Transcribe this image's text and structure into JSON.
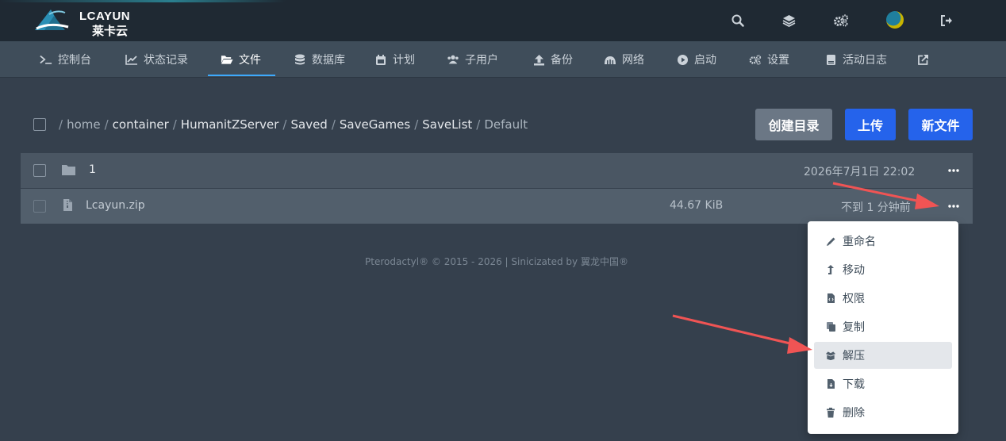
{
  "brand": {
    "name": "LCAYUN",
    "sub": "莱卡云"
  },
  "topbar": {
    "icons": [
      "search-icon",
      "layers-icon",
      "cogs-icon",
      "avatar",
      "sign-out-icon"
    ]
  },
  "nav": [
    {
      "label": "控制台",
      "icon": "terminal-icon"
    },
    {
      "label": "状态记录",
      "icon": "chart-line-icon"
    },
    {
      "label": "文件",
      "icon": "folder-open-icon",
      "active": true
    },
    {
      "label": "数据库",
      "icon": "database-icon"
    },
    {
      "label": "计划",
      "icon": "calendar-icon"
    },
    {
      "label": "子用户",
      "icon": "users-icon"
    },
    {
      "label": "备份",
      "icon": "upload-icon"
    },
    {
      "label": "网络",
      "icon": "network-icon"
    },
    {
      "label": "启动",
      "icon": "play-icon"
    },
    {
      "label": "设置",
      "icon": "cogs-icon"
    },
    {
      "label": "活动日志",
      "icon": "clipboard-icon"
    },
    {
      "label": "",
      "icon": "external-link-icon"
    }
  ],
  "breadcrumb": {
    "root": "/",
    "parts": [
      "home",
      "container",
      "HumanitZServer",
      "Saved",
      "SaveGames",
      "SaveList"
    ],
    "current": "Default"
  },
  "actions": {
    "create_dir": "创建目录",
    "upload": "上传",
    "new_file": "新文件"
  },
  "files": [
    {
      "name": "1",
      "type": "folder",
      "size": "",
      "modified": "2026年7月1日 22:02"
    },
    {
      "name": "Lcayun.zip",
      "type": "file",
      "size": "44.67 KiB",
      "modified": "不到 1 分钟前"
    }
  ],
  "footer": "Pterodactyl® © 2015 - 2026 | Sinicizated by 翼龙中国®",
  "context_menu": [
    {
      "label": "重命名",
      "icon": "pencil-icon"
    },
    {
      "label": "移动",
      "icon": "level-up-icon"
    },
    {
      "label": "权限",
      "icon": "file-code-icon"
    },
    {
      "label": "复制",
      "icon": "copy-icon"
    },
    {
      "label": "解压",
      "icon": "box-open-icon",
      "highlighted": true
    },
    {
      "label": "下载",
      "icon": "file-download-icon"
    },
    {
      "label": "删除",
      "icon": "trash-icon"
    }
  ],
  "colors": {
    "background": "#35404d",
    "topbar": "#1f2933",
    "navbar": "#3f4d5a",
    "accent_blue": "#2563eb",
    "annotation_arrow": "#f05454"
  }
}
